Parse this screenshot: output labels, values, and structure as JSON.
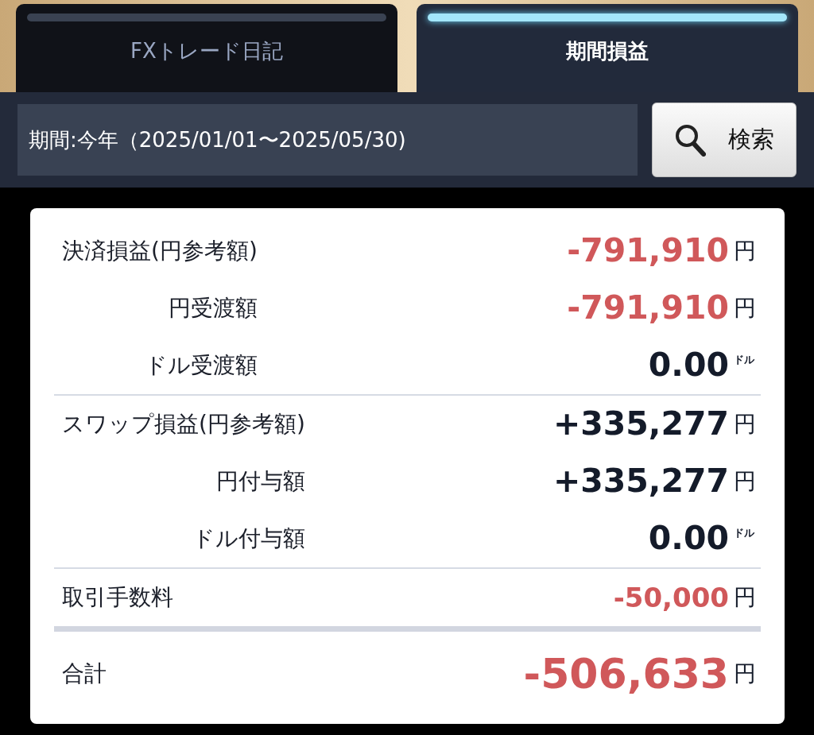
{
  "tabs": [
    {
      "label": "FXトレード日記",
      "selected": false
    },
    {
      "label": "期間損益",
      "selected": true
    }
  ],
  "filter": {
    "period": "期間:今年（2025/01/01〜2025/05/30)",
    "search_button": "検索"
  },
  "groups": [
    {
      "kind": "detail",
      "rows": [
        {
          "kind": "main",
          "label": "決済損益(円参考額)",
          "value": "-791,910",
          "unit": "円",
          "negative": true
        },
        {
          "kind": "sub",
          "label": "円受渡額",
          "value": "-791,910",
          "unit": "円",
          "negative": true
        },
        {
          "kind": "sub",
          "label": "ドル受渡額",
          "value": "0.00",
          "unit": "ドル",
          "negative": false
        }
      ]
    },
    {
      "kind": "detail",
      "rows": [
        {
          "kind": "main",
          "label": "スワップ損益(円参考額)",
          "value": "+335,277",
          "unit": "円",
          "negative": false
        },
        {
          "kind": "sub",
          "label": "円付与額",
          "value": "+335,277",
          "unit": "円",
          "negative": false
        },
        {
          "kind": "sub",
          "label": "ドル付与額",
          "value": "0.00",
          "unit": "ドル",
          "negative": false
        }
      ]
    },
    {
      "kind": "fee",
      "rows": [
        {
          "kind": "fee",
          "label": "取引手数料",
          "value": "-50,000",
          "unit": "円",
          "negative": true
        }
      ]
    },
    {
      "kind": "total",
      "rows": [
        {
          "kind": "total",
          "label": "合計",
          "value": "-506,633",
          "unit": "円",
          "negative": true
        }
      ]
    }
  ]
}
